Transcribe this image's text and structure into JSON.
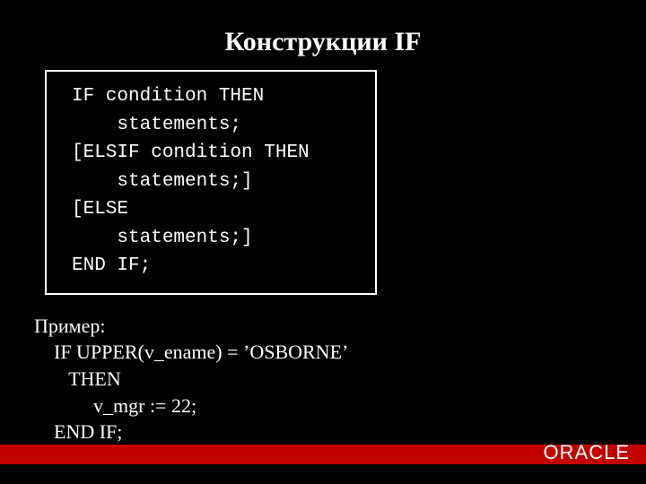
{
  "title": "Конструкции IF",
  "code_box": "IF condition THEN\n    statements;\n[ELSIF condition THEN\n    statements;]\n[ELSE\n    statements;]\nEND IF;",
  "example": "Пример:\n    IF UPPER(v_ename) = ’OSBORNE’\n       THEN\n            v_mgr := 22;\n    END IF;",
  "brand": "ORACLE",
  "colors": {
    "bg": "#000000",
    "fg": "#ffffff",
    "accent": "#c30000"
  }
}
